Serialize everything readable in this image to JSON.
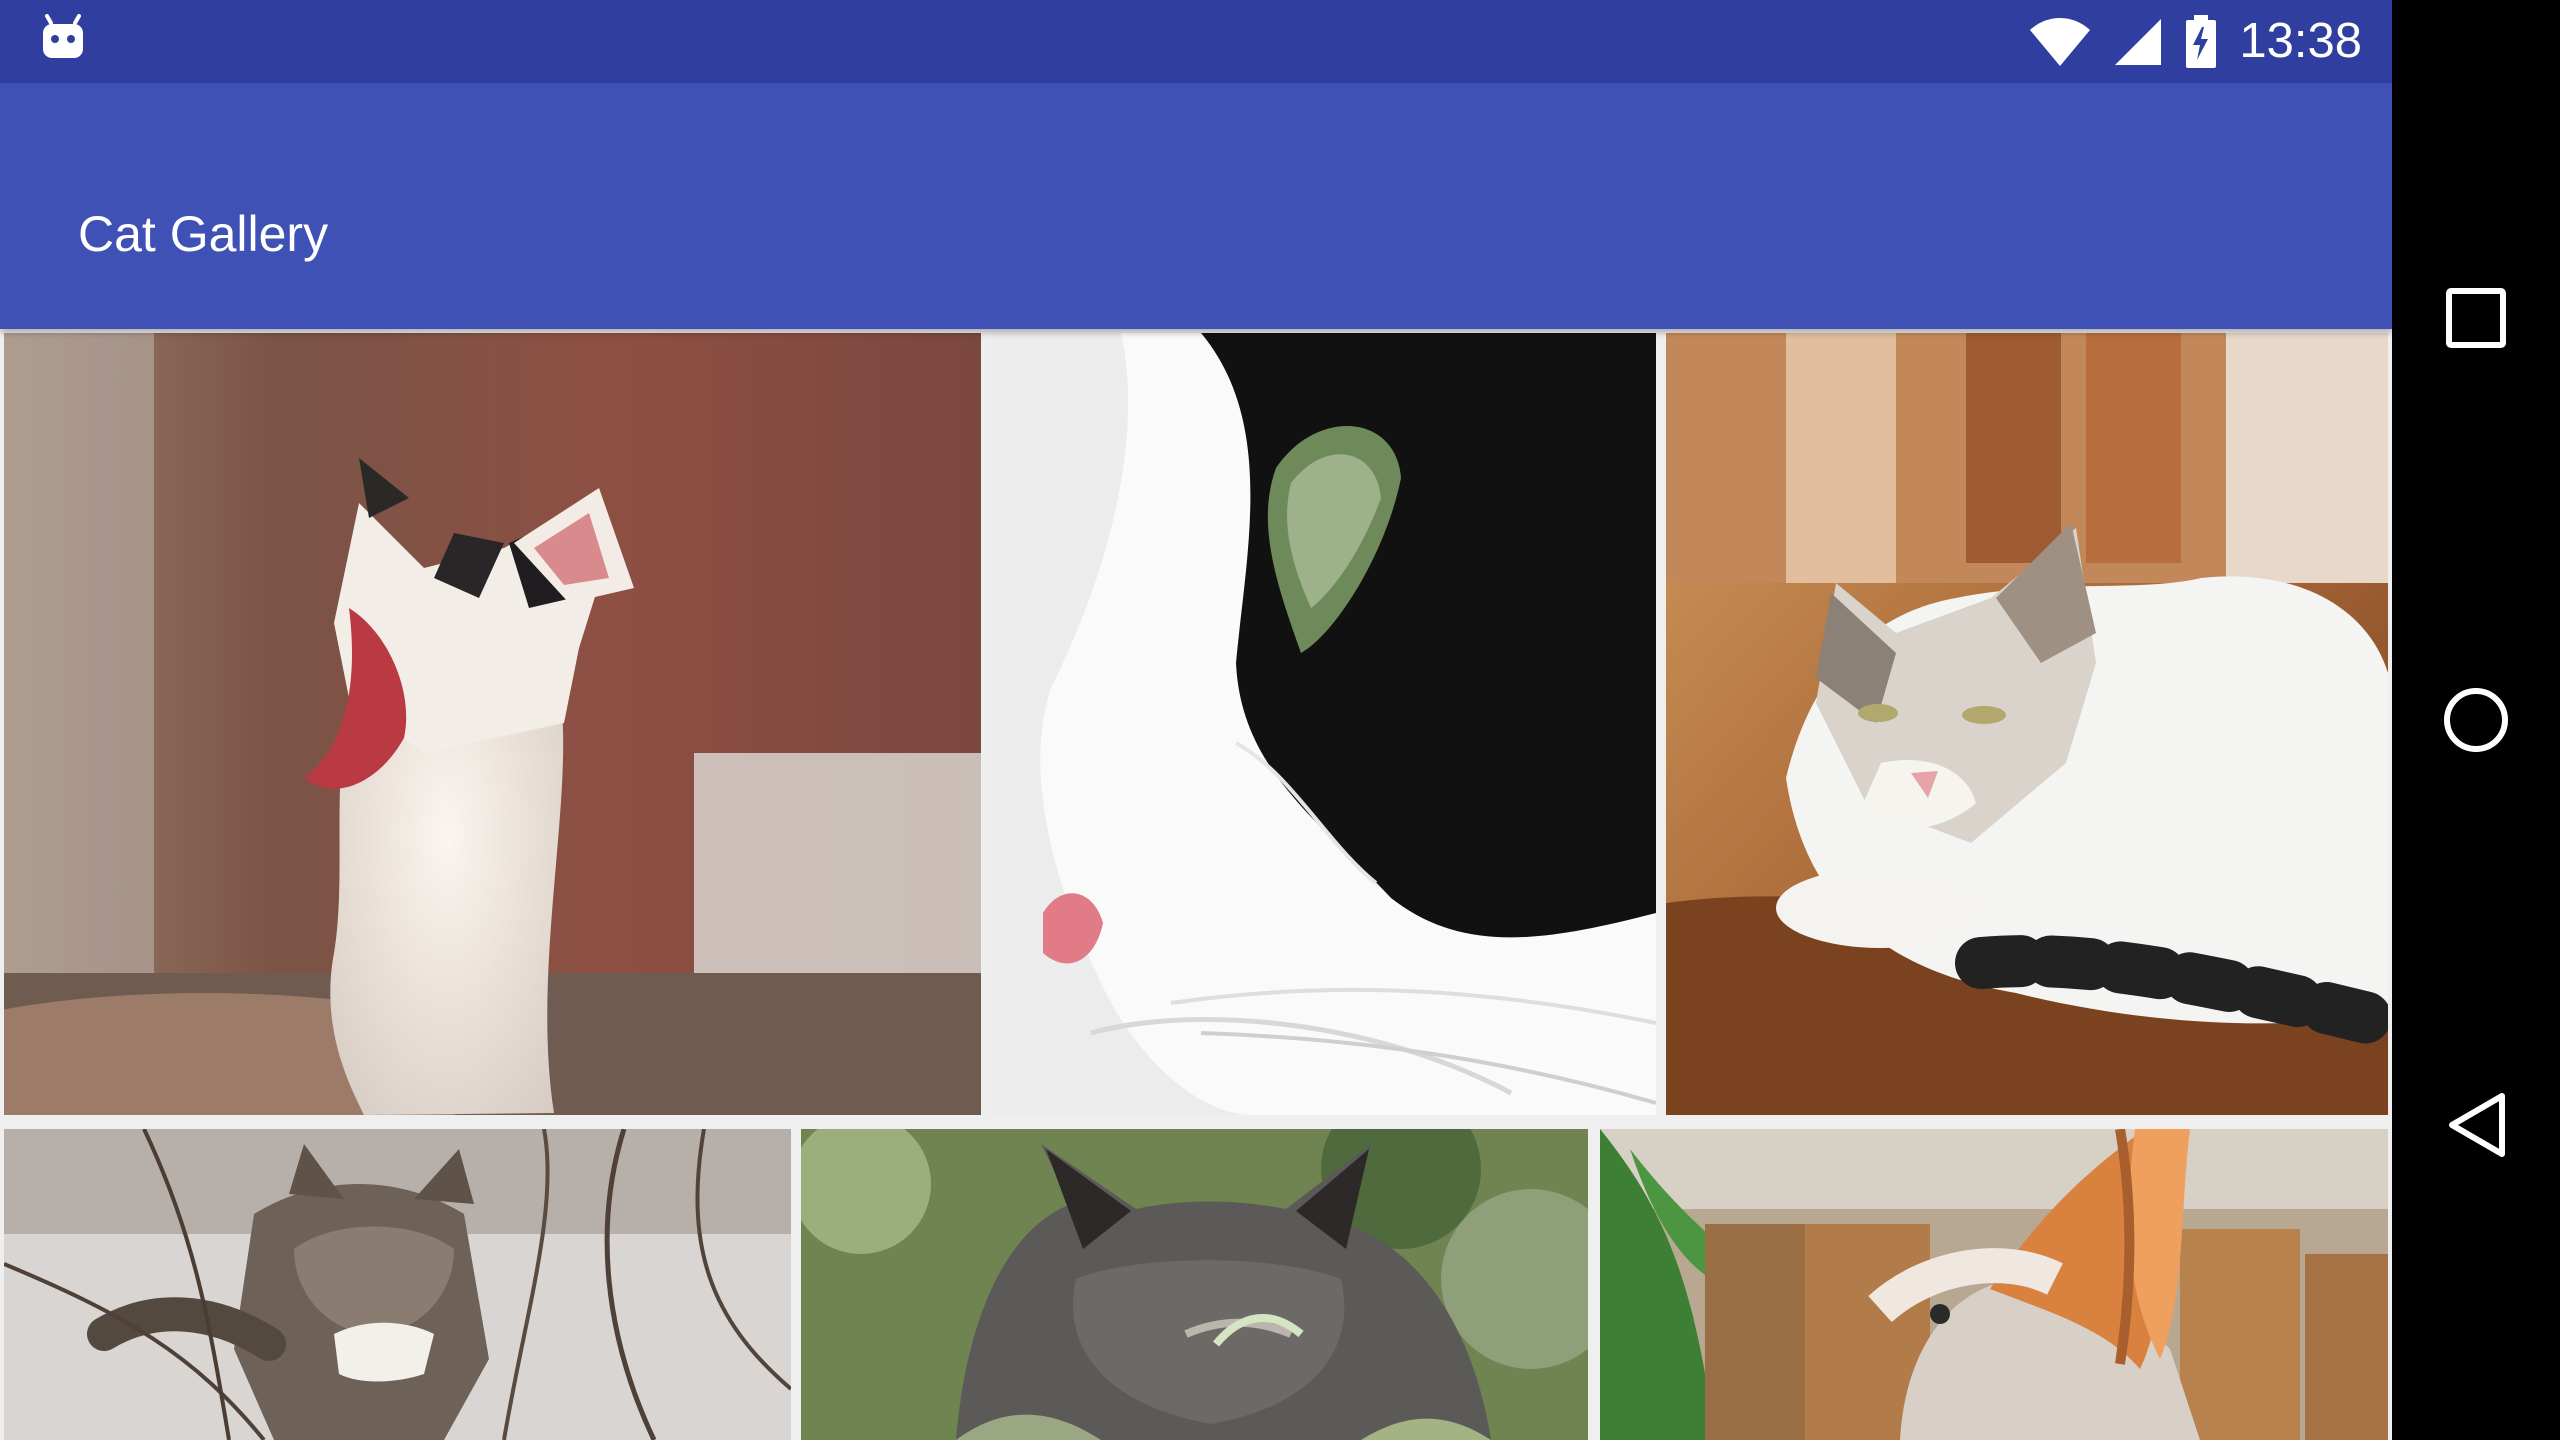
{
  "status_bar": {
    "time": "13:38",
    "icons": [
      "android-debug-icon",
      "wifi-icon",
      "cell-signal-icon",
      "battery-charging-icon"
    ]
  },
  "app_bar": {
    "title": "Cat Gallery"
  },
  "gallery": {
    "images": [
      {
        "name": "yawning-white-kitten",
        "icon": "cat-photo"
      },
      {
        "name": "black-white-cat-closeup",
        "icon": "cat-photo"
      },
      {
        "name": "tabby-white-cat-lying",
        "icon": "cat-photo"
      },
      {
        "name": "tabby-cat-branches",
        "icon": "cat-photo"
      },
      {
        "name": "grey-fluffy-cat",
        "icon": "cat-photo"
      },
      {
        "name": "orange-cat-chairs",
        "icon": "cat-photo"
      }
    ]
  },
  "navigation": {
    "buttons": [
      "recents-icon",
      "home-icon",
      "back-icon"
    ]
  },
  "colors": {
    "status_bar": "#303f9f",
    "app_bar": "#3f51b5",
    "nav_bar": "#000000",
    "white": "#ffffff"
  }
}
